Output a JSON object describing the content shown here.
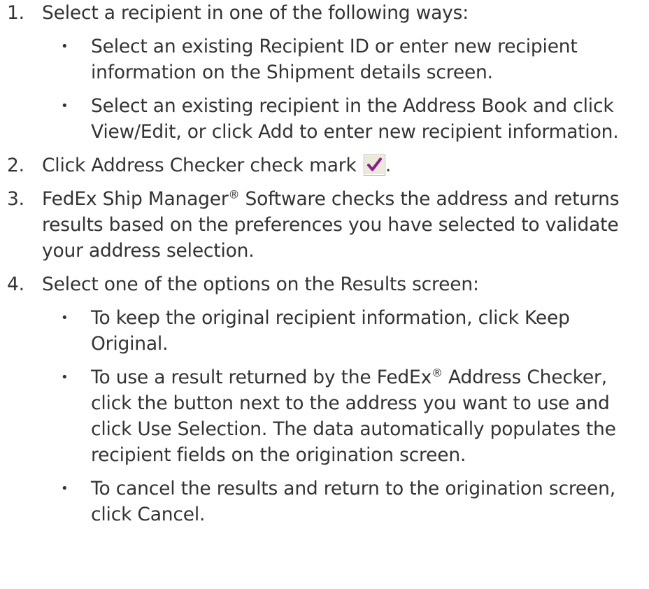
{
  "steps": [
    {
      "number": "1.",
      "text": "Select a recipient in one of the following ways:",
      "bullets": [
        "Select an existing Recipient ID or enter new recipient information on the Shipment details screen.",
        "Select an existing recipient in the Address Book and click View/Edit, or click Add to enter new recipient information."
      ]
    },
    {
      "number": "2.",
      "text": "Click Address Checker check mark",
      "trailing": ".",
      "icon": "check-mark-icon"
    },
    {
      "number": "3.",
      "text_before": "FedEx Ship Manager",
      "reg": "®",
      "text_after": " Software checks the address and returns results based on the preferences you have selected to validate your address selection."
    },
    {
      "number": "4.",
      "text": "Select one of the options on the Results screen:",
      "bullets_a": "To keep the original recipient information, click Keep Original.",
      "bullet_b_before": "To use a result returned by the FedEx",
      "bullet_b_reg": "®",
      "bullet_b_after": " Address Checker, click the button next to the address you want to use and click Use Selection. The data automatically populates the recipient fields on the origination screen.",
      "bullets_c": "To cancel the results and return to the origination screen, click Cancel."
    }
  ],
  "bullet_glyph": "•",
  "colors": {
    "text": "#333333",
    "check_mark": "#8b1a8b",
    "icon_bg": "#ece9d8"
  }
}
